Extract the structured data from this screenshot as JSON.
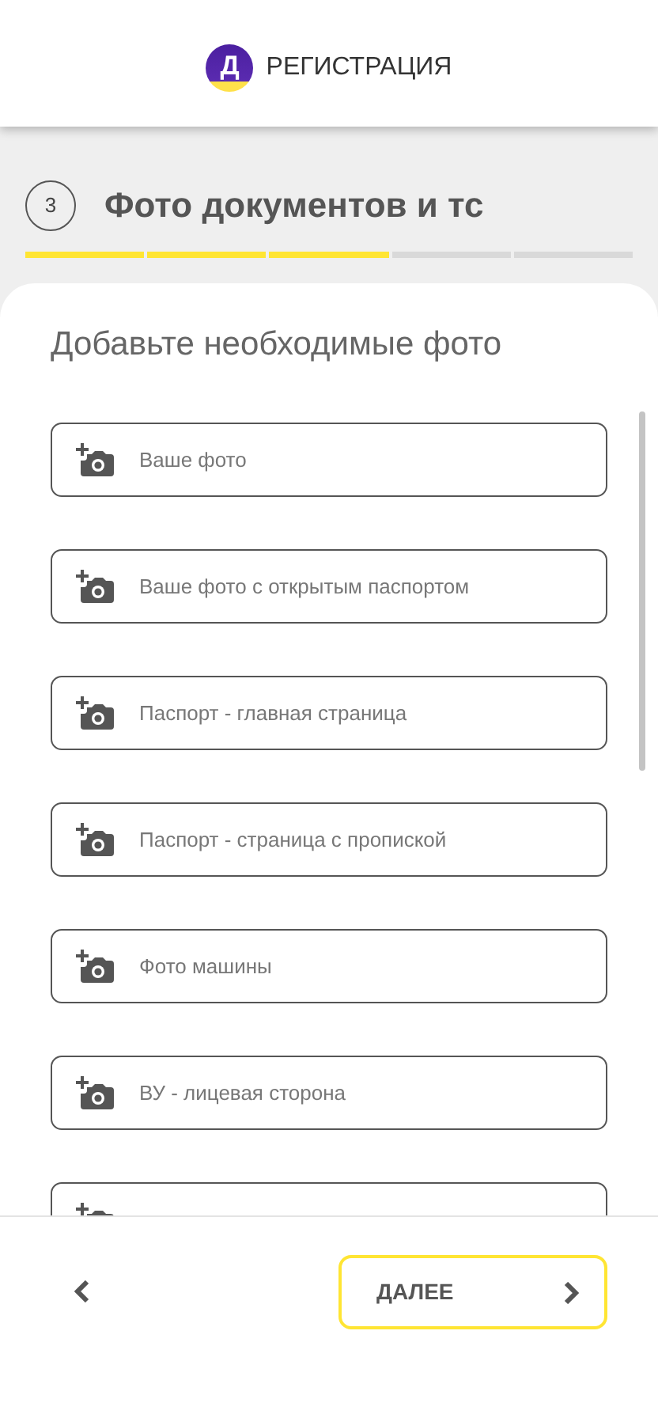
{
  "header": {
    "logo_letter": "Д",
    "title": "РЕГИСТРАЦИЯ"
  },
  "step": {
    "number": "3",
    "title": "Фото документов и тс"
  },
  "progress": [
    {
      "done": true
    },
    {
      "done": true
    },
    {
      "done": true
    },
    {
      "done": false
    },
    {
      "done": false
    }
  ],
  "heading": "Добавьте необходимые фото",
  "photos": [
    {
      "kind": "labeled",
      "label": "Ваше фото"
    },
    {
      "kind": "labeled",
      "label": "Ваше фото с открытым паспортом"
    },
    {
      "kind": "labeled",
      "label": "Паспорт - главная страница"
    },
    {
      "kind": "labeled",
      "label": "Паспорт - страница с пропиской"
    },
    {
      "kind": "labeled",
      "label": "Фото машины"
    },
    {
      "kind": "labeled",
      "label": "ВУ - лицевая сторона"
    },
    {
      "kind": "scrolled_off"
    }
  ],
  "footer": {
    "next_label": "ДАЛЕЕ"
  }
}
